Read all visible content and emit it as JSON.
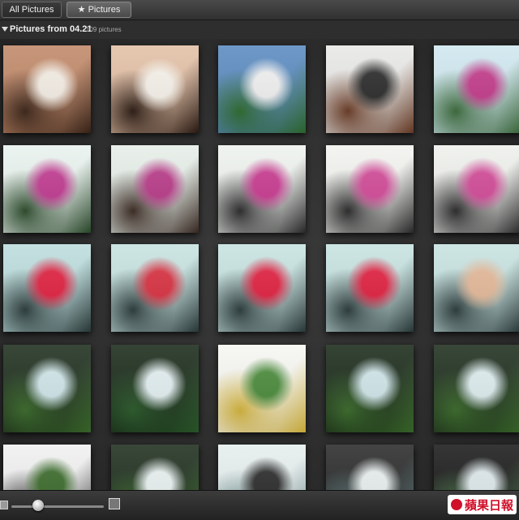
{
  "tabs": [
    {
      "label": "All Pictures"
    },
    {
      "label": "★ Pictures"
    }
  ],
  "album": {
    "title": "Pictures from 04.21",
    "count": "109 pictures"
  },
  "watermark": {
    "text": "蘋果日報"
  },
  "thumbnails": [
    {
      "scene": "woman selfie laughing",
      "colors": [
        "#c08868",
        "#f3ede4",
        "#3a2418"
      ]
    },
    {
      "scene": "woman selfie smiling",
      "colors": [
        "#e2bfa5",
        "#f6f2ea",
        "#2b1a12"
      ]
    },
    {
      "scene": "robot figure",
      "colors": [
        "#5a8ac0",
        "#f0f0f0",
        "#2d6a2d"
      ]
    },
    {
      "scene": "bag with photo",
      "colors": [
        "#e8e8e6",
        "#2a2a2a",
        "#6a3a24"
      ]
    },
    {
      "scene": "orchids hall",
      "colors": [
        "#cfe7ef",
        "#c23a8a",
        "#3a6a3a"
      ]
    },
    {
      "scene": "woman orchids",
      "colors": [
        "#e9f2ee",
        "#c03a90",
        "#2a4a2a"
      ]
    },
    {
      "scene": "woman orchids",
      "colors": [
        "#e6eee8",
        "#b83a88",
        "#3a2a22"
      ]
    },
    {
      "scene": "woman orchids",
      "colors": [
        "#eef2ee",
        "#c83a90",
        "#2a2a2a"
      ]
    },
    {
      "scene": "woman orchids",
      "colors": [
        "#f2f3ef",
        "#d24a98",
        "#2a2a2a"
      ]
    },
    {
      "scene": "woman orchids",
      "colors": [
        "#eef0ec",
        "#d24a98",
        "#2a2a2a"
      ]
    },
    {
      "scene": "woman terminal hall",
      "colors": [
        "#bcdcdc",
        "#e02040",
        "#2a3a3a"
      ]
    },
    {
      "scene": "woman terminal hall",
      "colors": [
        "#c6e2e0",
        "#d83040",
        "#2a3a3a"
      ]
    },
    {
      "scene": "woman terminal hall",
      "colors": [
        "#c6e2e0",
        "#e02040",
        "#2a3a3a"
      ]
    },
    {
      "scene": "woman terminal hall",
      "colors": [
        "#c6e2e0",
        "#e02040",
        "#2a3a3a"
      ]
    },
    {
      "scene": "woman terminal hall",
      "colors": [
        "#c6e2e0",
        "#e4b898",
        "#2a3a3a"
      ]
    },
    {
      "scene": "trees window",
      "colors": [
        "#1e2e1e",
        "#cfe5e8",
        "#3a6a2a"
      ]
    },
    {
      "scene": "trees window",
      "colors": [
        "#1a2a1a",
        "#e2eef0",
        "#2a5a2a"
      ]
    },
    {
      "scene": "bright garden",
      "colors": [
        "#f6f6f2",
        "#4a8a3a",
        "#d4b43a"
      ]
    },
    {
      "scene": "trees window",
      "colors": [
        "#1a2a1a",
        "#cfe5e8",
        "#3a6a2a"
      ]
    },
    {
      "scene": "trees window",
      "colors": [
        "#1e2e1e",
        "#dcecee",
        "#3a6a2a"
      ]
    },
    {
      "scene": "trees partial",
      "colors": [
        "#f0f0f0",
        "#3a6a2a",
        "#2a2a2a"
      ]
    },
    {
      "scene": "trees partial",
      "colors": [
        "#1e2e1e",
        "#e8f0f0",
        "#3a6a2a"
      ]
    },
    {
      "scene": "windows partial",
      "colors": [
        "#e6eeee",
        "#2a2a2a",
        "#6a8a8a"
      ]
    },
    {
      "scene": "window partial",
      "colors": [
        "#2a2a2a",
        "#e8eeee",
        "#5a7a7a"
      ]
    },
    {
      "scene": "window partial",
      "colors": [
        "#1a1a1a",
        "#dde8ea",
        "#4a7a4a"
      ]
    }
  ]
}
